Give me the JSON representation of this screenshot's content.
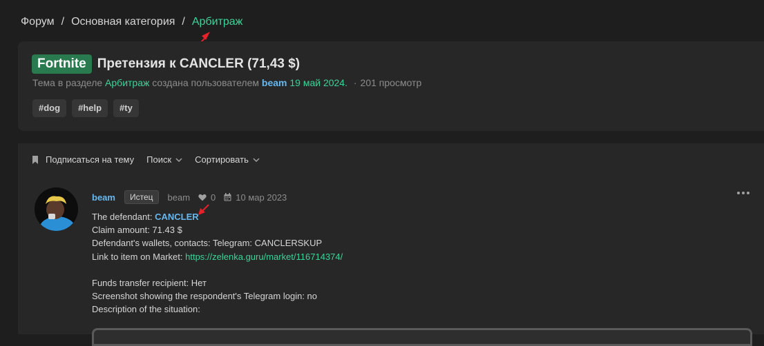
{
  "breadcrumb": {
    "items": [
      "Форум",
      "Основная категория",
      "Арбитраж"
    ],
    "separator": "/"
  },
  "thread": {
    "prefix": "Fortnite",
    "title": "Претензия к CANCLER (71,43 $)",
    "meta": {
      "text_before": "Тема в разделе",
      "section": "Арбитраж",
      "text_middle": "создана пользователем",
      "author": "beam",
      "date": "19 май 2024.",
      "separator": "·",
      "views": "201 просмотр"
    },
    "tags": [
      "#dog",
      "#help",
      "#ty"
    ]
  },
  "toolbar": {
    "subscribe": "Подписаться на тему",
    "search": "Поиск",
    "sort": "Сортировать"
  },
  "post": {
    "username": "beam",
    "badge": "Истец",
    "username_secondary": "beam",
    "likes": "0",
    "date": "10 мар 2023",
    "lines": {
      "defendant_label": "The defendant:",
      "defendant_value": "CANCLER",
      "claim": "Claim amount: 71.43 $",
      "wallets": "Defendant's wallets, contacts: Telegram: CANCLERSKUP",
      "link_label": "Link to item on Market:",
      "link_value": "https://zelenka.guru/market/116714374/",
      "recipient": "Funds transfer recipient: Нет",
      "screenshot": "Screenshot showing the respondent's Telegram login: no",
      "description": "Description of the situation:"
    }
  },
  "colors": {
    "background": "#1e1e1e",
    "card": "#272727",
    "accent_green": "#3ad49a",
    "prefix_green": "#2a7a4f",
    "link_blue": "#66b8f0",
    "annotation_red": "#e8202a"
  }
}
